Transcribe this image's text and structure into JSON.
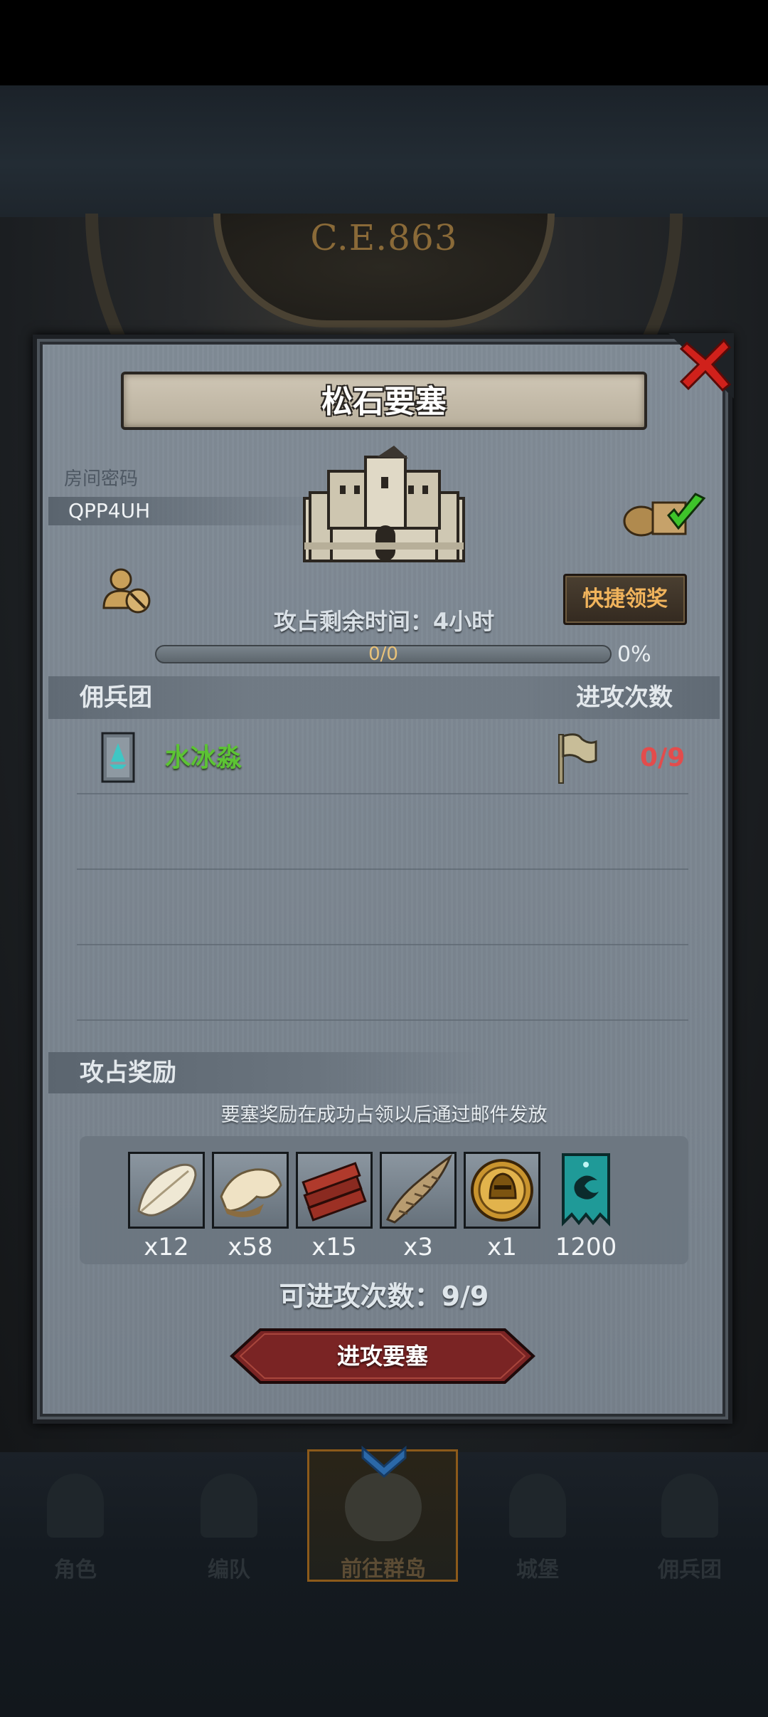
{
  "background": {
    "era_label": "C.E.863"
  },
  "dialog": {
    "title": "松石要塞",
    "room_code_label": "房间密码",
    "room_code_value": "QPP4UH",
    "quick_claim_label": "快捷领奖",
    "timer_label": "攻占剩余时间：4小时",
    "progress": {
      "current": "0/0",
      "percent": "0%",
      "fraction": 0
    },
    "mercenary_section": {
      "title": "佣兵团",
      "attack_count_header": "进攻次数",
      "guilds": [
        {
          "name": "水冰淼",
          "attacks": "0/9"
        }
      ]
    },
    "rewards_section": {
      "title": "攻占奖励",
      "note": "要塞奖励在成功占领以后通过邮件发放",
      "items": [
        {
          "icon": "feather-icon",
          "qty": "x12"
        },
        {
          "icon": "fur-pelt-icon",
          "qty": "x58"
        },
        {
          "icon": "wood-planks-icon",
          "qty": "x15"
        },
        {
          "icon": "horn-icon",
          "qty": "x3"
        },
        {
          "icon": "knight-helmet-coin-icon",
          "qty": "x1"
        },
        {
          "icon": "guild-banner-token-icon",
          "qty": "1200"
        }
      ]
    },
    "attacks_remaining": "可进攻次数：9/9",
    "attack_button_label": "进攻要塞"
  },
  "bottom_nav": {
    "items": [
      {
        "label": "角色",
        "active": false
      },
      {
        "label": "编队",
        "active": false
      },
      {
        "label": "前往群岛",
        "active": true
      },
      {
        "label": "城堡",
        "active": false
      },
      {
        "label": "佣兵团",
        "active": false
      }
    ]
  },
  "colors": {
    "guild_name": "#5cc334",
    "attack_count": "#e34c4c",
    "quick_claim_text": "#f0b35c",
    "close_button": "#d0211b",
    "attack_button": "#7a2424"
  }
}
